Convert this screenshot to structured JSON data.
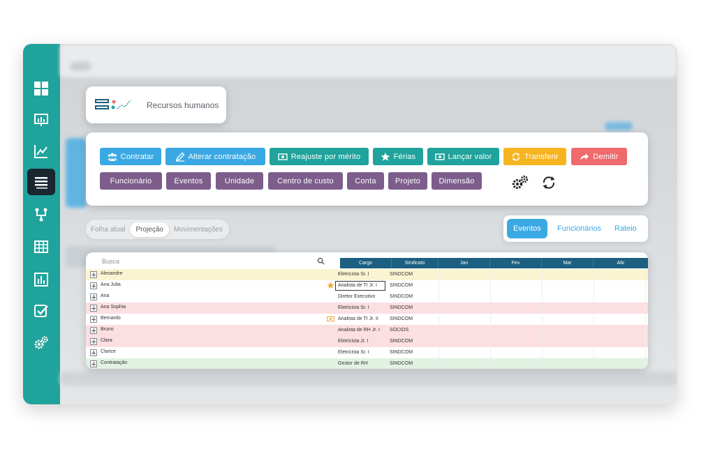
{
  "app": {
    "title": "Recursos humanos"
  },
  "sidebar": {
    "items": [
      {
        "icon": "dashboard-icon"
      },
      {
        "icon": "presentation-icon"
      },
      {
        "icon": "line-chart-icon"
      },
      {
        "icon": "list-icon",
        "active": true
      },
      {
        "icon": "hierarchy-icon"
      },
      {
        "icon": "table-icon"
      },
      {
        "icon": "bar-chart-icon"
      },
      {
        "icon": "checkbox-icon"
      },
      {
        "icon": "gears-icon"
      }
    ]
  },
  "toolbar": {
    "row1": [
      {
        "label": "Contratar",
        "icon": "people-icon",
        "color": "#3aa9e3"
      },
      {
        "label": "Alterar contratação",
        "icon": "pencil-icon",
        "color": "#3aa9e3"
      },
      {
        "label": "Reajuste por mérito",
        "icon": "money-icon",
        "color": "#1fa39c"
      },
      {
        "label": "Férias",
        "icon": "star-icon",
        "color": "#1fa39c"
      },
      {
        "label": "Lançar valor",
        "icon": "money-icon",
        "color": "#1fa39c"
      },
      {
        "label": "Transferir",
        "icon": "sync-icon",
        "color": "#f7b421"
      },
      {
        "label": "Demitir",
        "icon": "share-arrow-icon",
        "color": "#ef6a6c"
      }
    ],
    "row2": [
      {
        "label": "Funcionário"
      },
      {
        "label": "Eventos"
      },
      {
        "label": "Unidade"
      },
      {
        "label": "Centro de custo"
      },
      {
        "label": "Conta"
      },
      {
        "label": "Projeto"
      },
      {
        "label": "Dimensão"
      }
    ]
  },
  "view_tabs": {
    "items": [
      "Folha atual",
      "Projeção",
      "Movimentações"
    ],
    "selected": "Projeção"
  },
  "panel_tabs": {
    "items": [
      "Eventos",
      "Funcionários",
      "Rateio"
    ],
    "selected": "Eventos"
  },
  "grid": {
    "search_placeholder": "Busca",
    "columns": [
      "Cargo",
      "Sindicato",
      "Jan",
      "Fev",
      "Mar",
      "Abr"
    ],
    "rows": [
      {
        "name": "Alexandre",
        "cargo": "Eletricista Sr. I",
        "sindicato": "SINDCOM",
        "bg": "#fbf4d2"
      },
      {
        "name": "Ana Julia",
        "cargo": "Analista de TI Jr. I",
        "sindicato": "SINDCOM",
        "bg": "#ffffff",
        "mark": "star-icon",
        "selected": true
      },
      {
        "name": "Ana",
        "cargo": "Diretor Executivo",
        "sindicato": "SINDCOM",
        "bg": "#ffffff"
      },
      {
        "name": "Ana Sophia",
        "cargo": "Eletricista Sr. I",
        "sindicato": "SINDCOM",
        "bg": "#fbdfe1"
      },
      {
        "name": "Bernardo",
        "cargo": "Analista de TI Jr. II",
        "sindicato": "SINDCOM",
        "bg": "#ffffff",
        "mark": "money-icon"
      },
      {
        "name": "Bruno",
        "cargo": "Analista de RH Jr. I",
        "sindicato": "SÓCIOS",
        "bg": "#fbdfe1"
      },
      {
        "name": "Clara",
        "cargo": "Eletricista Jr. I",
        "sindicato": "SINDCOM",
        "bg": "#fbdfe1"
      },
      {
        "name": "Clarice",
        "cargo": "Eletricista Sr. I",
        "sindicato": "SINDCOM",
        "bg": "#ffffff"
      },
      {
        "name": "Contratação",
        "cargo": "Gestor de RH",
        "sindicato": "SINDCOM",
        "bg": "#e1f1e2"
      }
    ]
  },
  "colors": {
    "sidebar": "#1fa39c",
    "sidebar_active": "#1a2630",
    "header": "#1c5f80",
    "blue": "#3aa9e3",
    "teal": "#1fa39c",
    "yellow": "#f7b421",
    "red": "#ef6a6c",
    "purple": "#7d5d8b"
  }
}
